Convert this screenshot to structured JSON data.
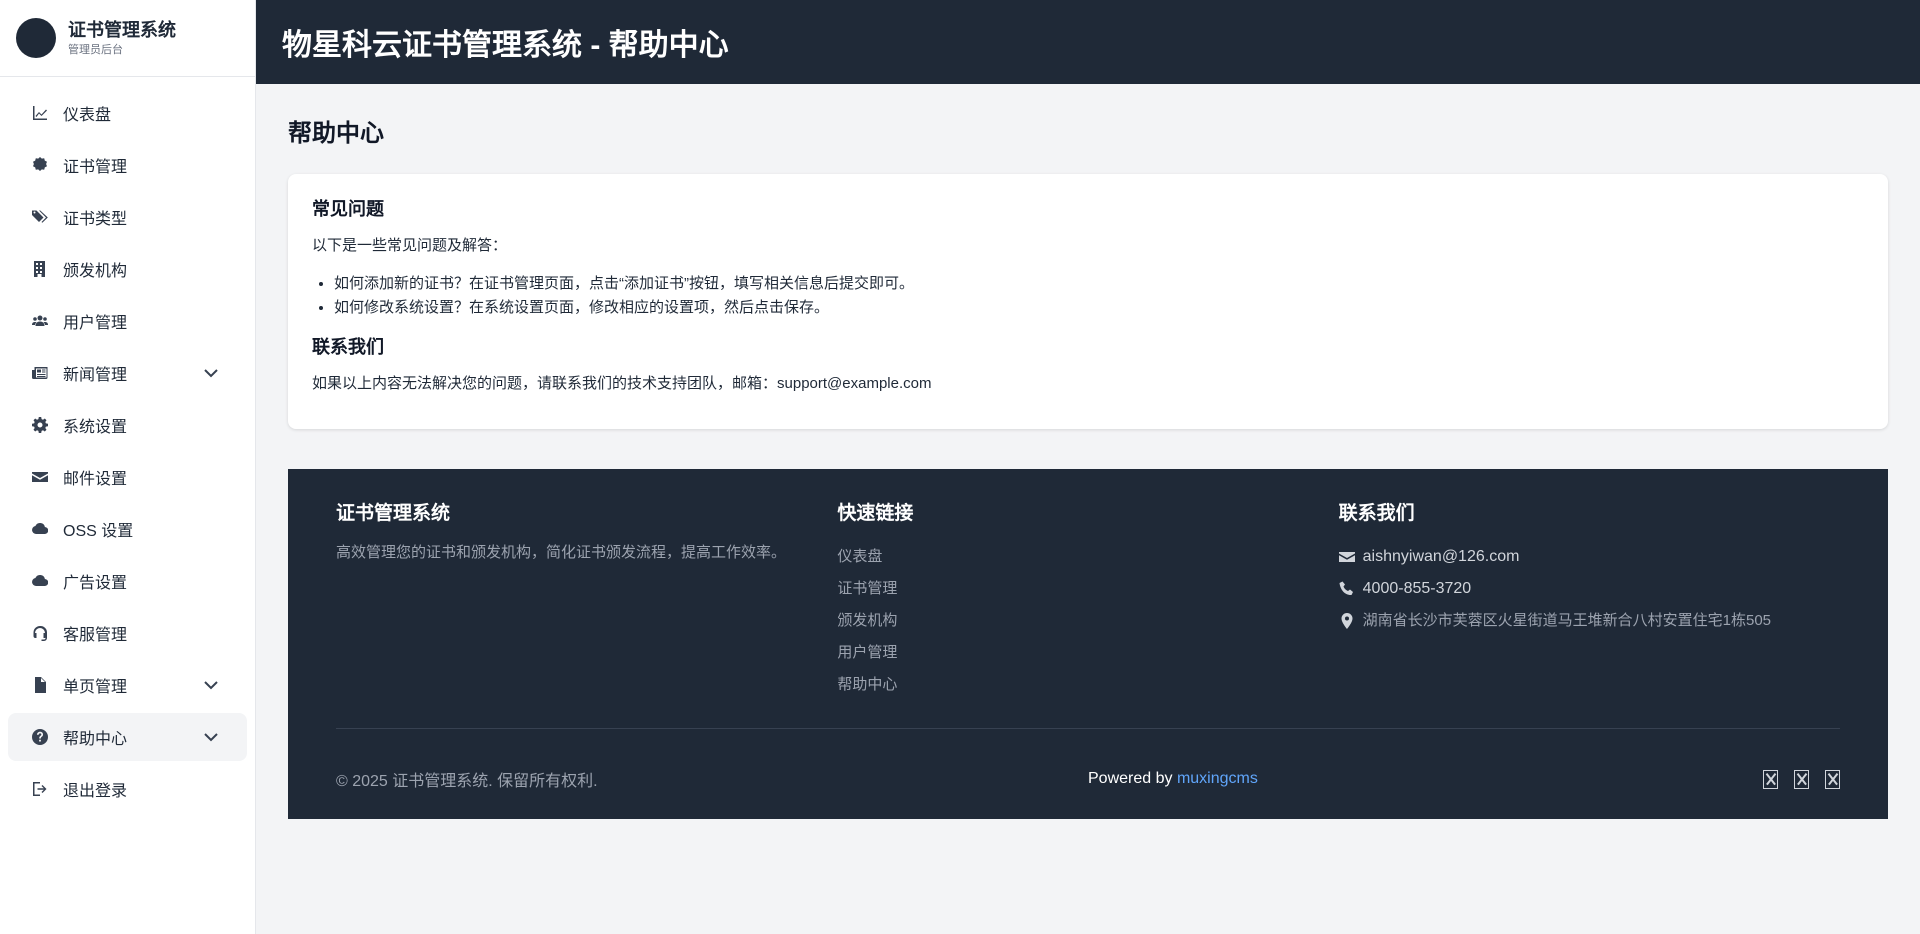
{
  "sidebar": {
    "brand_title": "证书管理系统",
    "brand_subtitle": "管理员后台",
    "items": [
      {
        "label": "仪表盘",
        "icon": "chart-line-icon"
      },
      {
        "label": "证书管理",
        "icon": "certificate-icon"
      },
      {
        "label": "证书类型",
        "icon": "tags-icon"
      },
      {
        "label": "颁发机构",
        "icon": "building-icon"
      },
      {
        "label": "用户管理",
        "icon": "users-icon"
      },
      {
        "label": "新闻管理",
        "icon": "newspaper-icon",
        "expandable": true
      },
      {
        "label": "系统设置",
        "icon": "gear-icon"
      },
      {
        "label": "邮件设置",
        "icon": "envelope-icon"
      },
      {
        "label": "OSS 设置",
        "icon": "cloud-icon"
      },
      {
        "label": "广告设置",
        "icon": "cloud-icon"
      },
      {
        "label": "客服管理",
        "icon": "headset-icon"
      },
      {
        "label": "单页管理",
        "icon": "file-icon",
        "expandable": true
      },
      {
        "label": "帮助中心",
        "icon": "question-circle-icon",
        "expandable": true,
        "active": true
      },
      {
        "label": "退出登录",
        "icon": "sign-out-icon"
      }
    ]
  },
  "header": {
    "title": "物星科云证书管理系统 - 帮助中心"
  },
  "main": {
    "page_title": "帮助中心",
    "faq_title": "常见问题",
    "faq_intro": "以下是一些常见问题及解答：",
    "faq_items": [
      "如何添加新的证书？在证书管理页面，点击“添加证书”按钮，填写相关信息后提交即可。",
      "如何修改系统设置？在系统设置页面，修改相应的设置项，然后点击保存。"
    ],
    "contact_title": "联系我们",
    "contact_text": "如果以上内容无法解决您的问题，请联系我们的技术支持团队，邮箱：support@example.com"
  },
  "footer": {
    "col1_title": "证书管理系统",
    "col1_desc": "高效管理您的证书和颁发机构，简化证书颁发流程，提高工作效率。",
    "col2_title": "快速链接",
    "links": [
      "仪表盘",
      "证书管理",
      "颁发机构",
      "用户管理",
      "帮助中心"
    ],
    "col3_title": "联系我们",
    "email": "aishnyiwan@126.com",
    "phone": "4000-855-3720",
    "address": "湖南省长沙市芙蓉区火星街道马王堆新合八村安置住宅1栋505",
    "copyright": "© 2025 证书管理系统. 保留所有权利.",
    "powered_prefix": "Powered by ",
    "powered_link": "muxingcms"
  },
  "colors": {
    "dark": "#1f2937",
    "link_blue": "#60a5fa",
    "background": "#f3f4f6"
  }
}
